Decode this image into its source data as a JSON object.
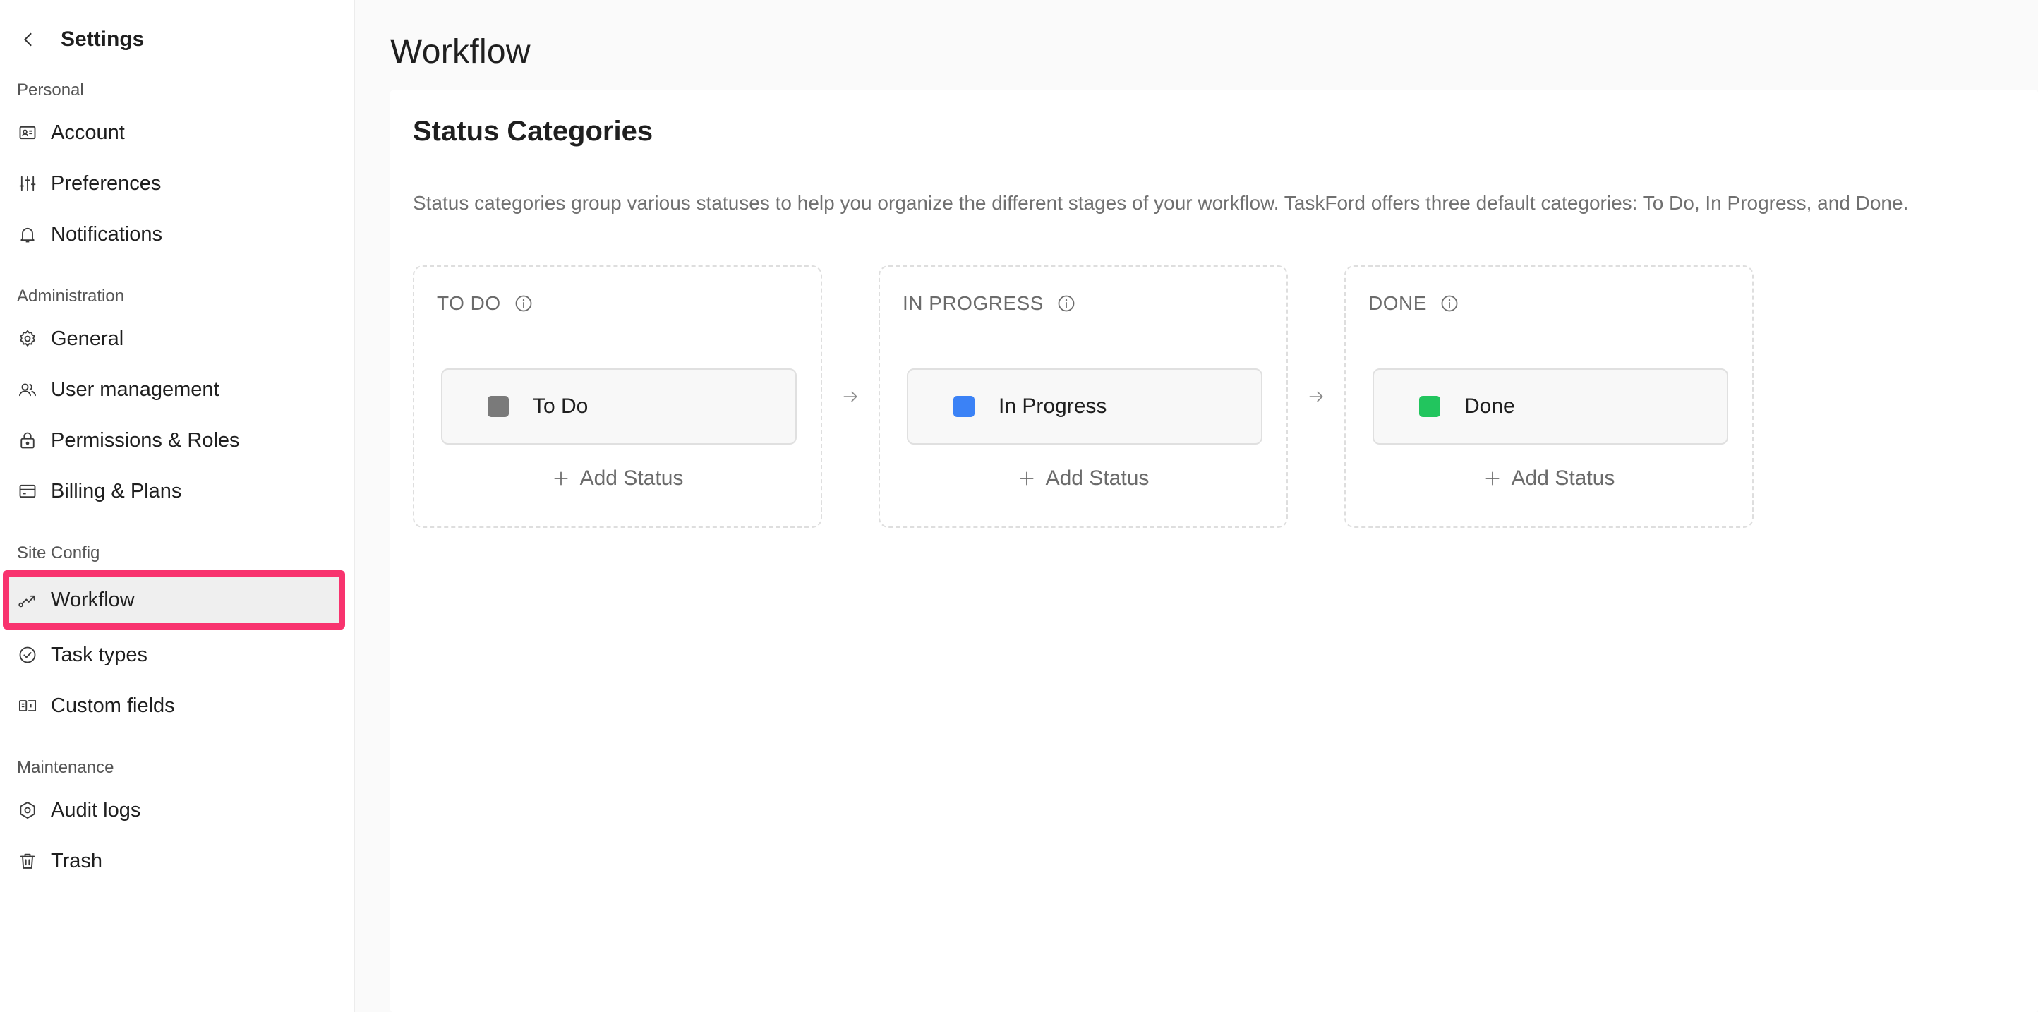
{
  "sidebar": {
    "title": "Settings",
    "sections": [
      {
        "label": "Personal",
        "items": [
          {
            "label": "Account",
            "icon": "account-card-icon"
          },
          {
            "label": "Preferences",
            "icon": "sliders-icon"
          },
          {
            "label": "Notifications",
            "icon": "bell-icon"
          }
        ]
      },
      {
        "label": "Administration",
        "items": [
          {
            "label": "General",
            "icon": "gear-icon"
          },
          {
            "label": "User management",
            "icon": "users-icon"
          },
          {
            "label": "Permissions & Roles",
            "icon": "lock-icon"
          },
          {
            "label": "Billing & Plans",
            "icon": "credit-card-icon"
          }
        ]
      },
      {
        "label": "Site Config",
        "items": [
          {
            "label": "Workflow",
            "icon": "workflow-icon",
            "active": true
          },
          {
            "label": "Task types",
            "icon": "check-circle-icon"
          },
          {
            "label": "Custom fields",
            "icon": "custom-field-icon"
          }
        ]
      },
      {
        "label": "Maintenance",
        "items": [
          {
            "label": "Audit logs",
            "icon": "hexagon-icon"
          },
          {
            "label": "Trash",
            "icon": "trash-icon"
          }
        ]
      }
    ]
  },
  "main": {
    "title": "Workflow",
    "card": {
      "title": "Status Categories",
      "description": "Status categories group various statuses to help you organize the different stages of your workflow. TaskFord offers three default categories: To Do, In Progress, and Done.",
      "categories": [
        {
          "name": "TO DO",
          "status": "To Do",
          "color": "#7a7a7a",
          "add_label": "Add Status"
        },
        {
          "name": "IN PROGRESS",
          "status": "In Progress",
          "color": "#3b82f6",
          "add_label": "Add Status"
        },
        {
          "name": "DONE",
          "status": "Done",
          "color": "#22c55e",
          "add_label": "Add Status"
        }
      ]
    }
  },
  "colors": {
    "highlight": "#f8336e",
    "active_bg": "#efefef",
    "todo": "#7a7a7a",
    "in_progress": "#3b82f6",
    "done": "#22c55e"
  }
}
